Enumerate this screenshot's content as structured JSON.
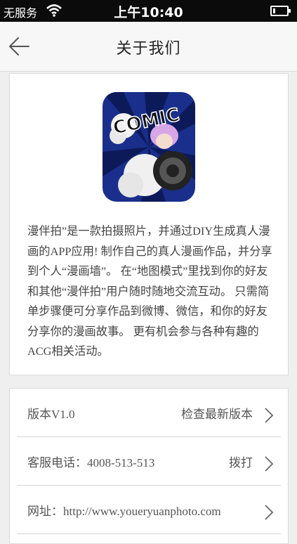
{
  "status_bar": {
    "carrier": "无服务",
    "time": "上午10:40"
  },
  "nav": {
    "title": "关于我们"
  },
  "about": {
    "logo_text": "COMIC",
    "description": "漫伴拍”是一款拍摄照片，并通过DIY生成真人漫画的APP应用! 制作自己的真人漫画作品，并分享到个人“漫画墙”。 在“地图模式”里找到你的好友和其他“漫伴拍”用户随时随地交流互动。 只需简单步骤便可分享作品到微博、微信，和你的好友分享你的漫画故事。 更有机会参与各种有趣的ACG相关活动。"
  },
  "rows": [
    {
      "left": "版本V1.0",
      "right": "检查最新版本"
    },
    {
      "left": "客服电话：4008-513-513",
      "right": "拨打"
    },
    {
      "left": "网址：http://www.youeryuanphoto.com",
      "right": ""
    }
  ]
}
